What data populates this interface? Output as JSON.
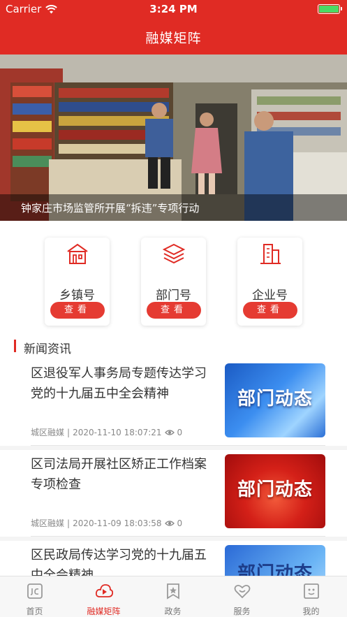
{
  "status_bar": {
    "carrier": "Carrier",
    "time": "3:24 PM"
  },
  "header": {
    "title": "融媒矩阵"
  },
  "banner": {
    "caption": "钟家庄市场监管所开展“拆违”专项行动"
  },
  "cards": [
    {
      "label": "乡镇号",
      "button": "查看",
      "icon": "township-building-icon"
    },
    {
      "label": "部门号",
      "button": "查看",
      "icon": "layers-icon"
    },
    {
      "label": "企业号",
      "button": "查看",
      "icon": "office-buildings-icon"
    }
  ],
  "news_section": {
    "title": "新闻资讯"
  },
  "news": [
    {
      "title": "区退役军人事务局专题传达学习党的十九届五中全会精神",
      "source": "城区融媒",
      "sep": "|",
      "datetime": "2020-11-10 18:07:21",
      "views": "0",
      "thumb_text": "部门动态"
    },
    {
      "title": "区司法局开展社区矫正工作档案专项检查",
      "source": "城区融媒",
      "sep": "|",
      "datetime": "2020-11-09 18:03:58",
      "views": "0",
      "thumb_text": "部门动态"
    },
    {
      "title": "区民政局传达学习党的十九届五中全会精神",
      "source": "",
      "sep": "",
      "datetime": "",
      "views": "",
      "thumb_text": "部门动态"
    }
  ],
  "tabbar": [
    {
      "label": "首页",
      "icon": "home-icon"
    },
    {
      "label": "融媒矩阵",
      "icon": "cloud-play-icon",
      "active": true
    },
    {
      "label": "政务",
      "icon": "star-bookmark-icon"
    },
    {
      "label": "服务",
      "icon": "heart-icon"
    },
    {
      "label": "我的",
      "icon": "profile-icon"
    }
  ],
  "colors": {
    "brand_red": "#e02b24",
    "battery_green": "#4cd964"
  }
}
